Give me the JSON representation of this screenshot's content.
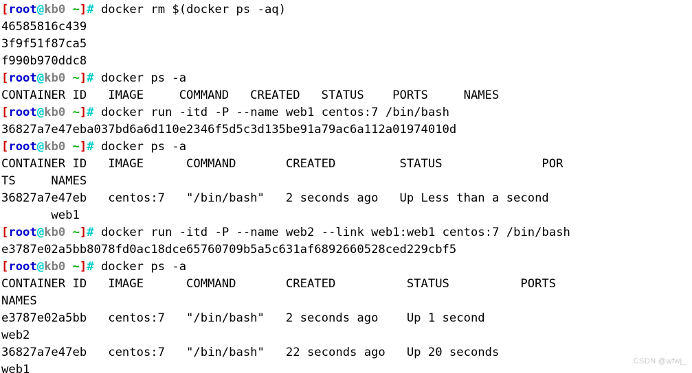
{
  "terminal": {
    "shell_type": "bash",
    "colors": {
      "background": "#ffffff",
      "foreground": "#000000",
      "bracket": "#cc0000",
      "user": "#0000cc",
      "at_sign": "#00cccc",
      "host": "#808080",
      "path": "#00b300",
      "prompt_symbol": "#00cccc"
    },
    "prompt": {
      "open_bracket": "[",
      "user": "root",
      "at": "@",
      "host": "kb0",
      "space_path": " ~",
      "close_bracket": "]",
      "symbol": "#",
      "trailing_space": " "
    },
    "lines": [
      {
        "type": "prompt",
        "command": "docker rm $(docker ps -aq)"
      },
      {
        "type": "output",
        "text": "46585816c439"
      },
      {
        "type": "output",
        "text": "3f9f51f87ca5"
      },
      {
        "type": "output",
        "text": "f990b970ddc8"
      },
      {
        "type": "prompt",
        "command": "docker ps -a"
      },
      {
        "type": "output",
        "text": "CONTAINER ID   IMAGE     COMMAND   CREATED   STATUS    PORTS     NAMES"
      },
      {
        "type": "prompt",
        "command": "docker run -itd -P --name web1 centos:7 /bin/bash"
      },
      {
        "type": "output",
        "text": "36827a7e47eba037bd6a6d110e2346f5d5c3d135be91a79ac6a112a01974010d"
      },
      {
        "type": "prompt",
        "command": "docker ps -a"
      },
      {
        "type": "output",
        "text": "CONTAINER ID   IMAGE      COMMAND       CREATED         STATUS              POR"
      },
      {
        "type": "output",
        "text": "TS     NAMES"
      },
      {
        "type": "output",
        "text": "36827a7e47eb   centos:7   \"/bin/bash\"   2 seconds ago   Up Less than a second"
      },
      {
        "type": "output",
        "text": "       web1"
      },
      {
        "type": "prompt",
        "command": "docker run -itd -P --name web2 --link web1:web1 centos:7 /bin/bash"
      },
      {
        "type": "output",
        "text": "e3787e02a5bb8078fd0ac18dce65760709b5a5c631af6892660528ced229cbf5"
      },
      {
        "type": "prompt",
        "command": "docker ps -a"
      },
      {
        "type": "output",
        "text": "CONTAINER ID   IMAGE      COMMAND       CREATED          STATUS          PORTS"
      },
      {
        "type": "output",
        "text": "NAMES"
      },
      {
        "type": "output",
        "text": "e3787e02a5bb   centos:7   \"/bin/bash\"   2 seconds ago    Up 1 second"
      },
      {
        "type": "output",
        "text": "web2"
      },
      {
        "type": "output",
        "text": "36827a7e47eb   centos:7   \"/bin/bash\"   22 seconds ago   Up 20 seconds"
      },
      {
        "type": "output",
        "text": "web1"
      }
    ],
    "docker_ps_tables": [
      {
        "headers": [
          "CONTAINER ID",
          "IMAGE",
          "COMMAND",
          "CREATED",
          "STATUS",
          "PORTS",
          "NAMES"
        ],
        "rows": []
      },
      {
        "headers": [
          "CONTAINER ID",
          "IMAGE",
          "COMMAND",
          "CREATED",
          "STATUS",
          "PORTS",
          "NAMES"
        ],
        "rows": [
          [
            "36827a7e47eb",
            "centos:7",
            "\"/bin/bash\"",
            "2 seconds ago",
            "Up Less than a second",
            "",
            "web1"
          ]
        ]
      },
      {
        "headers": [
          "CONTAINER ID",
          "IMAGE",
          "COMMAND",
          "CREATED",
          "STATUS",
          "PORTS",
          "NAMES"
        ],
        "rows": [
          [
            "e3787e02a5bb",
            "centos:7",
            "\"/bin/bash\"",
            "2 seconds ago",
            "Up 1 second",
            "",
            "web2"
          ],
          [
            "36827a7e47eb",
            "centos:7",
            "\"/bin/bash\"",
            "22 seconds ago",
            "Up 20 seconds",
            "",
            "web1"
          ]
        ]
      }
    ],
    "removed_container_ids": [
      "46585816c439",
      "3f9f51f87ca5",
      "f990b970ddc8"
    ],
    "created_container_ids": [
      "36827a7e47eba037bd6a6d110e2346f5d5c3d135be91a79ac6a112a01974010d",
      "e3787e02a5bb8078fd0ac18dce65760709b5a5c631af6892660528ced229cbf5"
    ]
  },
  "watermark": {
    "text": "CSDN @wfwj_"
  }
}
